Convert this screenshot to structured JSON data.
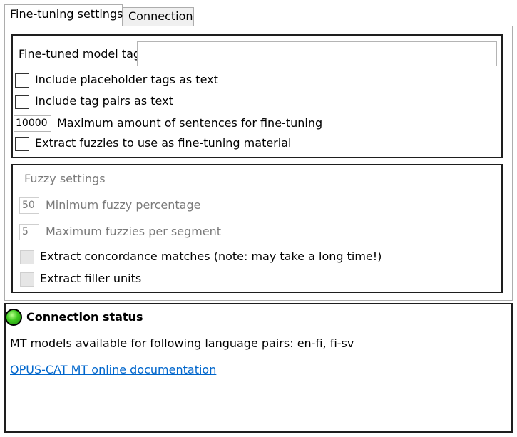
{
  "tabs": [
    {
      "label": "Fine-tuning settings",
      "active": true
    },
    {
      "label": "Connection",
      "active": false
    }
  ],
  "finetune": {
    "model_tag_label": "Fine-tuned model tag",
    "model_tag_value": "",
    "include_placeholder_label": "Include placeholder tags as text",
    "include_placeholder_checked": false,
    "include_tag_pairs_label": "Include tag pairs as text",
    "include_tag_pairs_checked": false,
    "max_sentences_value": "10000",
    "max_sentences_label": "Maximum amount of sentences for fine-tuning",
    "extract_fuzzies_label": "Extract fuzzies to use as fine-tuning material",
    "extract_fuzzies_checked": false
  },
  "fuzzy": {
    "group_title": "Fuzzy settings",
    "min_percentage_value": "50",
    "min_percentage_label": "Minimum fuzzy percentage",
    "max_fuzzies_value": "5",
    "max_fuzzies_label": "Maximum fuzzies per segment",
    "concordance_label": "Extract concordance matches (note: may take a long time!)",
    "filler_label": "Extract filler units",
    "enabled": false
  },
  "connection": {
    "status_title": "Connection status",
    "status_color": "#3dc81e",
    "models_text": "MT models available for following language pairs: en-fi, fi-sv",
    "doc_link": "OPUS-CAT MT online documentation"
  }
}
